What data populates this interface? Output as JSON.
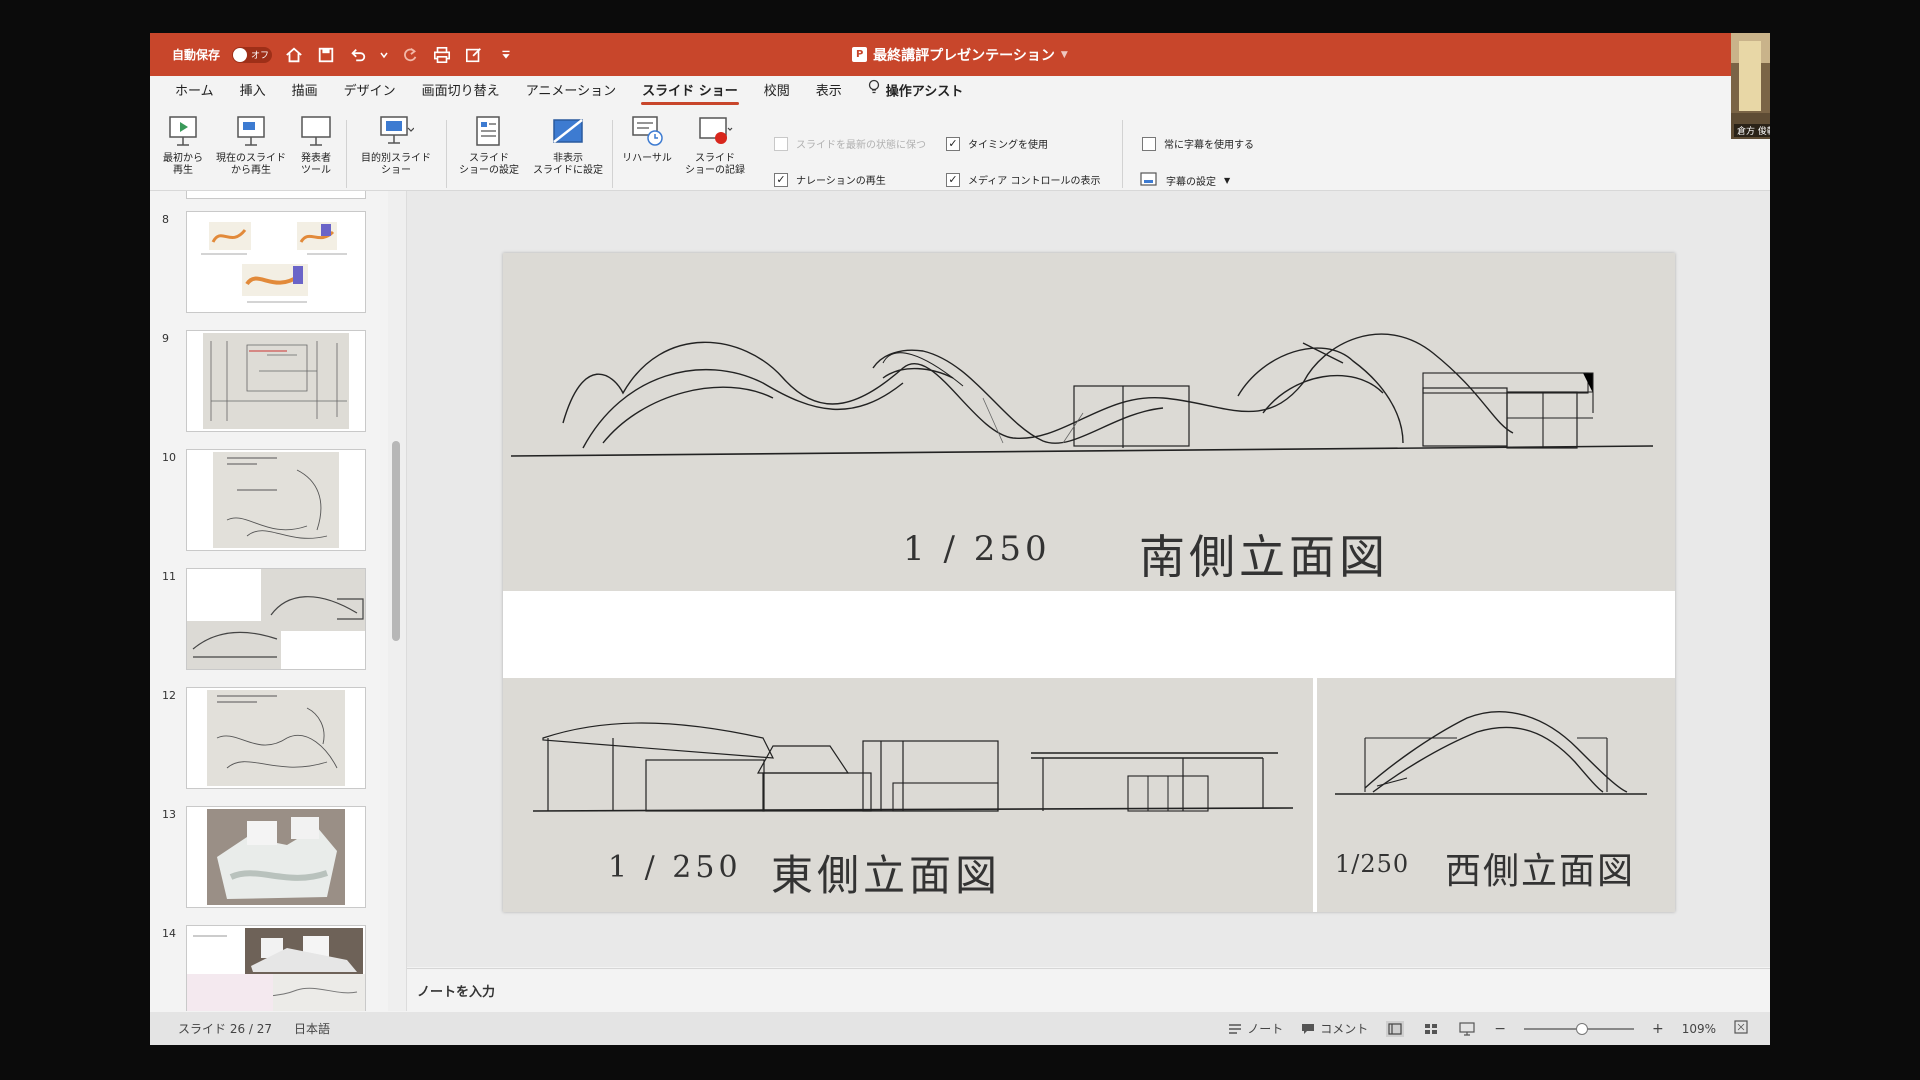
{
  "titlebar": {
    "autosave_label": "自動保存",
    "autosave_state": "オフ",
    "doc_title": "最終講評プレゼンテーション",
    "app_badge": "P",
    "color": "#c8462b"
  },
  "tabs": [
    {
      "label": "ホーム"
    },
    {
      "label": "挿入"
    },
    {
      "label": "描画"
    },
    {
      "label": "デザイン"
    },
    {
      "label": "画面切り替え"
    },
    {
      "label": "アニメーション"
    },
    {
      "label": "スライド ショー",
      "active": true
    },
    {
      "label": "校閲"
    },
    {
      "label": "表示"
    },
    {
      "label": "操作アシスト",
      "bulb": true
    }
  ],
  "ribbon": {
    "from_start": "最初から\n再生",
    "from_current": "現在のスライド\nから再生",
    "presenter_tools": "発表者\nツール",
    "custom_show": "目的別スライド\nショー",
    "setup_show": "スライド\nショーの設定",
    "hide_slide": "非表示\nスライドに設定",
    "rehearse": "リハーサル",
    "record": "スライド\nショーの記録",
    "keep_updated": "スライドを最新の状態に保つ",
    "use_timings": "タイミングを使用",
    "play_narrations": "ナレーションの再生",
    "show_media_controls": "メディア コントロールの表示",
    "always_subtitles": "常に字幕を使用する",
    "subtitle_settings": "字幕の設定"
  },
  "thumbnails": [
    {
      "num": "8"
    },
    {
      "num": "9"
    },
    {
      "num": "10"
    },
    {
      "num": "11"
    },
    {
      "num": "12"
    },
    {
      "num": "13"
    },
    {
      "num": "14"
    }
  ],
  "slide": {
    "south_scale": "1 / 250",
    "south_title": "南側立面図",
    "east_scale": "1 / 250",
    "east_title": "東側立面図",
    "west_scale": "1/250",
    "west_title": "西側立面図"
  },
  "notes_placeholder": "ノートを入力",
  "status": {
    "slide_info": "スライド 26 / 27",
    "language": "日本語",
    "notes_btn": "ノート",
    "comments_btn": "コメント",
    "zoom": "109%"
  },
  "webcam": {
    "name": "倉方 俊輔"
  }
}
